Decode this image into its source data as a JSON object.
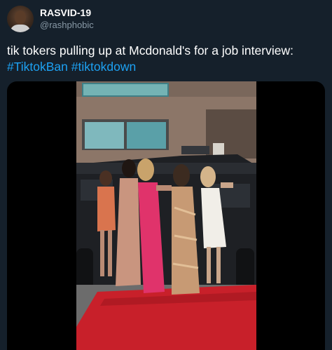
{
  "author": {
    "display_name": "RASVID-19",
    "handle": "@rashphobic"
  },
  "tweet": {
    "text": "tik tokers pulling up at Mcdonald's for a job interview:",
    "hashtags": [
      "#TiktokBan",
      "#tiktokdown"
    ]
  },
  "colors": {
    "background": "#15202b",
    "text": "#ffffff",
    "secondary_text": "#8899a6",
    "link": "#1da1f2"
  },
  "icons": {
    "avatar": "profile-photo",
    "media": "video-thumbnail"
  }
}
